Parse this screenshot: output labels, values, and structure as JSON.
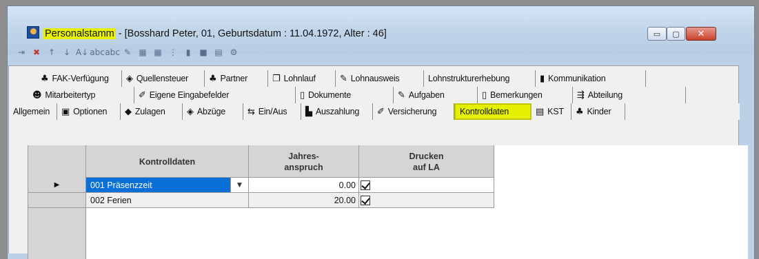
{
  "window": {
    "title_app": "Personalstamm",
    "title_rest": " - [Bosshard Peter, 01, Geburtsdatum : 11.04.1972, Alter : 46]",
    "controls": {
      "minimize": "▭",
      "maximize": "▢",
      "close": "✕"
    }
  },
  "toolbar": {
    "icons": [
      {
        "name": "insert-row-icon",
        "glyph": "⇥"
      },
      {
        "name": "delete-row-icon",
        "glyph": "✖"
      },
      {
        "name": "move-up-icon",
        "glyph": "↑"
      },
      {
        "name": "move-down-icon",
        "glyph": "↓"
      },
      {
        "name": "sort-az-icon",
        "glyph": "A↓"
      },
      {
        "name": "spellcheck-icon",
        "glyph": "abc"
      },
      {
        "name": "spellcheck2-icon",
        "glyph": "abc"
      },
      {
        "name": "edit-icon",
        "glyph": "✎"
      },
      {
        "name": "grid-icon",
        "glyph": "▦"
      },
      {
        "name": "grid2-icon",
        "glyph": "▦"
      },
      {
        "name": "columns-icon",
        "glyph": "⋮"
      },
      {
        "name": "chart-icon",
        "glyph": "▮"
      },
      {
        "name": "save-icon",
        "glyph": "■"
      },
      {
        "name": "calculator-icon",
        "glyph": "▤"
      },
      {
        "name": "settings-icon",
        "glyph": "⚙"
      }
    ]
  },
  "tabs": {
    "row1": [
      {
        "label": "FAK-Verfügung",
        "icon": "♣",
        "icon_name": "people-icon"
      },
      {
        "label": "Quellensteuer",
        "icon": "◈",
        "icon_name": "tax-icon"
      },
      {
        "label": "Partner",
        "icon": "♣",
        "icon_name": "partner-icon"
      },
      {
        "label": "Lohnlauf",
        "icon": "❐",
        "icon_name": "payroll-run-icon"
      },
      {
        "label": "Lohnausweis",
        "icon": "✎",
        "icon_name": "salary-certificate-icon"
      },
      {
        "label": "Lohnstrukturerhebung",
        "icon": "",
        "icon_name": ""
      },
      {
        "label": "Kommunikation",
        "icon": "▮",
        "icon_name": "phone-icon"
      }
    ],
    "row2": [
      {
        "label": "Mitarbeitertyp",
        "icon": "☻",
        "icon_name": "employee-type-icon"
      },
      {
        "label": "Eigene Eingabefelder",
        "icon": "✐",
        "icon_name": "custom-fields-icon"
      },
      {
        "label": "Dokumente",
        "icon": "▯",
        "icon_name": "documents-icon"
      },
      {
        "label": "Aufgaben",
        "icon": "✎",
        "icon_name": "tasks-icon"
      },
      {
        "label": "Bemerkungen",
        "icon": "▯",
        "icon_name": "notes-icon"
      },
      {
        "label": "Abteilung",
        "icon": "⇶",
        "icon_name": "department-icon"
      }
    ],
    "row3": [
      {
        "label": "Allgemein",
        "icon": "",
        "icon_name": ""
      },
      {
        "label": "Optionen",
        "icon": "▣",
        "icon_name": "options-icon"
      },
      {
        "label": "Zulagen",
        "icon": "◆",
        "icon_name": "allowances-icon"
      },
      {
        "label": "Abzüge",
        "icon": "◈",
        "icon_name": "deductions-icon"
      },
      {
        "label": "Ein/Aus",
        "icon": "⇆",
        "icon_name": "entry-exit-icon"
      },
      {
        "label": "Auszahlung",
        "icon": "▙",
        "icon_name": "payment-icon"
      },
      {
        "label": "Versicherung",
        "icon": "✐",
        "icon_name": "insurance-icon"
      },
      {
        "label": "Kontrolldaten",
        "icon": "",
        "icon_name": "",
        "active": true
      },
      {
        "label": "KST",
        "icon": "▤",
        "icon_name": "cost-center-icon"
      },
      {
        "label": "Kinder",
        "icon": "♣",
        "icon_name": "children-icon"
      }
    ]
  },
  "grid": {
    "headers": {
      "kontrolldaten": "Kontrolldaten",
      "jahresanspruch_1": "Jahres-",
      "jahresanspruch_2": "anspruch",
      "drucken_1": "Drucken",
      "drucken_2": "auf LA"
    },
    "rows": [
      {
        "indicator": "▶",
        "name": "001 Präsenzzeit",
        "value": "0.00",
        "print": true,
        "selected": true
      },
      {
        "indicator": "",
        "name": "002 Ferien",
        "value": "20.00",
        "print": true,
        "selected": false
      }
    ]
  }
}
